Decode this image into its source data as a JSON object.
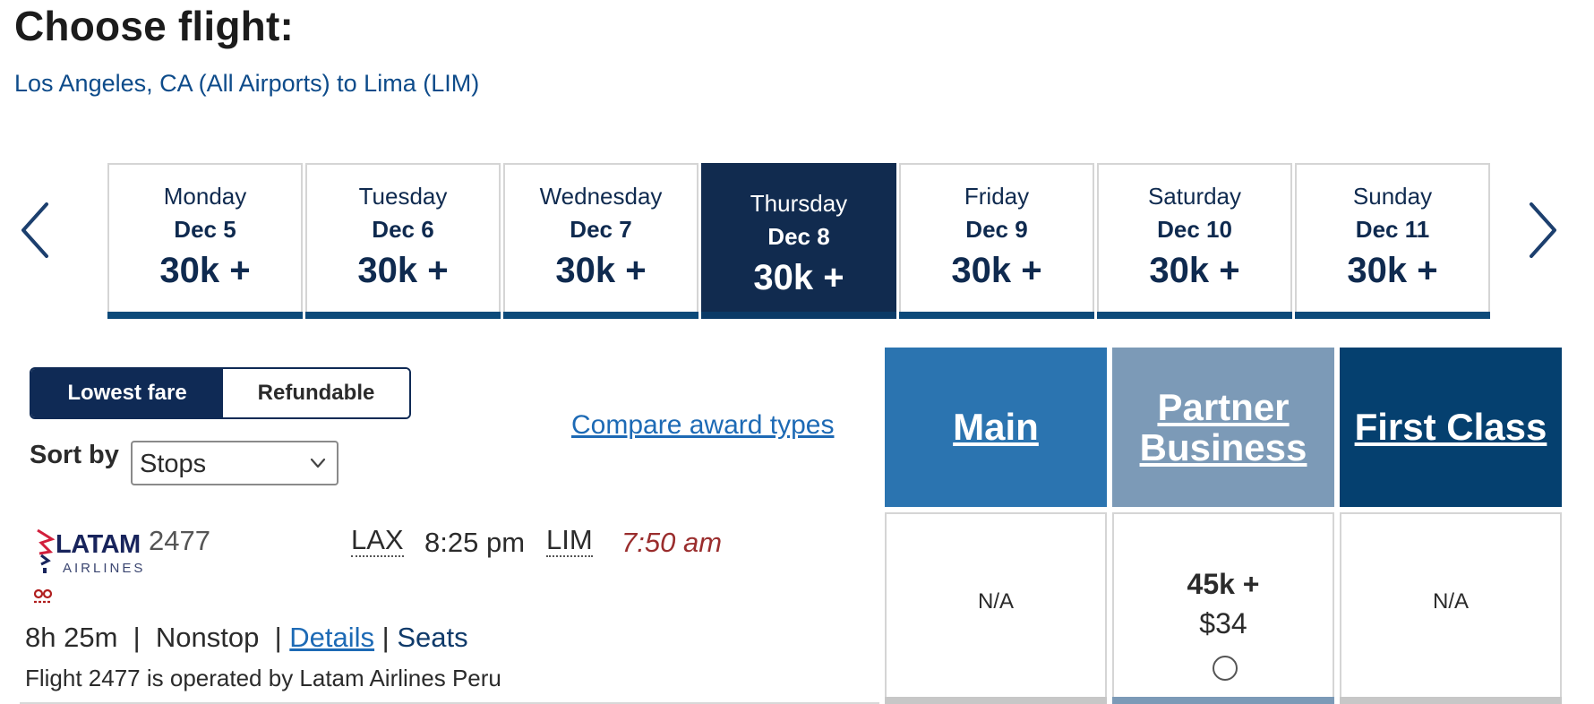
{
  "page": {
    "title": "Choose flight:",
    "route": "Los Angeles, CA (All Airports) to Lima (LIM)"
  },
  "date_nav": {
    "prev_icon": "chevron-left-icon",
    "next_icon": "chevron-right-icon",
    "selected_index": 3,
    "days": [
      {
        "day": "Monday",
        "date": "Dec 5",
        "points": "30k +"
      },
      {
        "day": "Tuesday",
        "date": "Dec 6",
        "points": "30k +"
      },
      {
        "day": "Wednesday",
        "date": "Dec 7",
        "points": "30k +"
      },
      {
        "day": "Thursday",
        "date": "Dec 8",
        "points": "30k +"
      },
      {
        "day": "Friday",
        "date": "Dec 9",
        "points": "30k +"
      },
      {
        "day": "Saturday",
        "date": "Dec 10",
        "points": "30k +"
      },
      {
        "day": "Sunday",
        "date": "Dec 11",
        "points": "30k +"
      }
    ]
  },
  "fare_toggle": {
    "lowest": "Lowest fare",
    "refundable": "Refundable",
    "active": "lowest"
  },
  "sort": {
    "label": "Sort by",
    "value": "Stops"
  },
  "compare_link": "Compare award types",
  "cabins": [
    {
      "name": "Main",
      "color": "#2b74b0"
    },
    {
      "name": "Partner Business",
      "line1": "Partner",
      "line2": "Business",
      "color": "#7c9ab7"
    },
    {
      "name": "First Class",
      "color": "#05406f"
    }
  ],
  "flight": {
    "airline_logo_text": "LATAM",
    "airline_logo_sub": "AIRLINES",
    "number": "2477",
    "dep_code": "LAX",
    "dep_time": "8:25 pm",
    "arr_code": "LIM",
    "arr_time": "7:50 am",
    "duration": "8h 25m",
    "stops": "Nonstop",
    "details_link": "Details",
    "seats_link": "Seats",
    "operated_by": "Flight 2477 is operated by Latam Airlines Peru",
    "fares": {
      "main": "N/A",
      "partner_points": "45k +",
      "partner_fee": "$34",
      "first": "N/A"
    }
  },
  "colors": {
    "navy": "#112b4f",
    "link": "#1d6ab5",
    "arrival_time": "#9a2d2d"
  }
}
